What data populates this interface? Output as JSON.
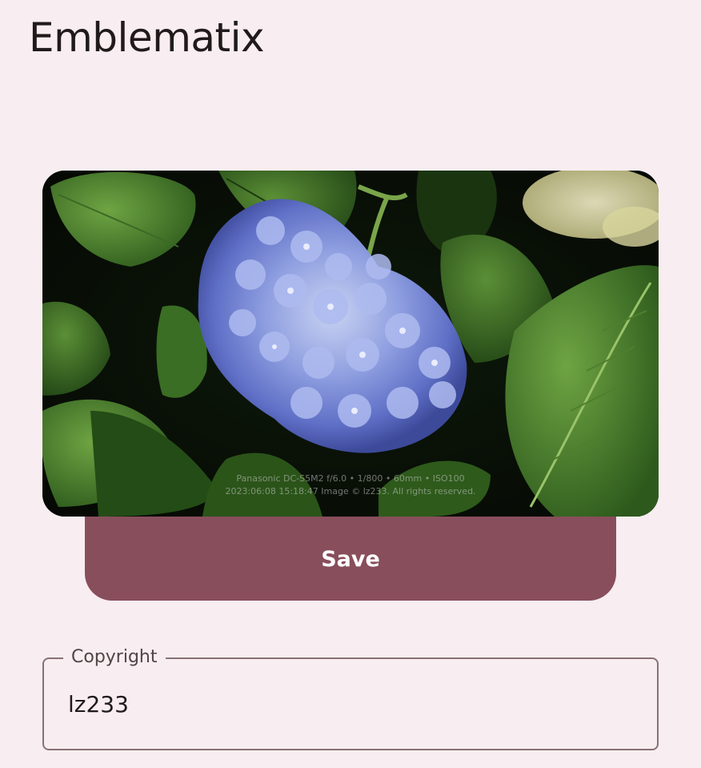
{
  "app": {
    "title": "Emblematix"
  },
  "preview": {
    "exif_line_1": "Panasonic DC-S5M2  f/6.0 • 1/800 • 60mm • ISO100",
    "exif_line_2": "2023:06:08 15:18:47  Image © lz233. All rights reserved.",
    "image_subject": "hydrangea-photo"
  },
  "actions": {
    "save_label": "Save"
  },
  "copyright_field": {
    "label": "Copyright",
    "value": "lz233"
  },
  "colors": {
    "background": "#f8edf0",
    "primary_button": "#884e5c",
    "outline": "#877276",
    "on_surface": "#201a1b"
  }
}
